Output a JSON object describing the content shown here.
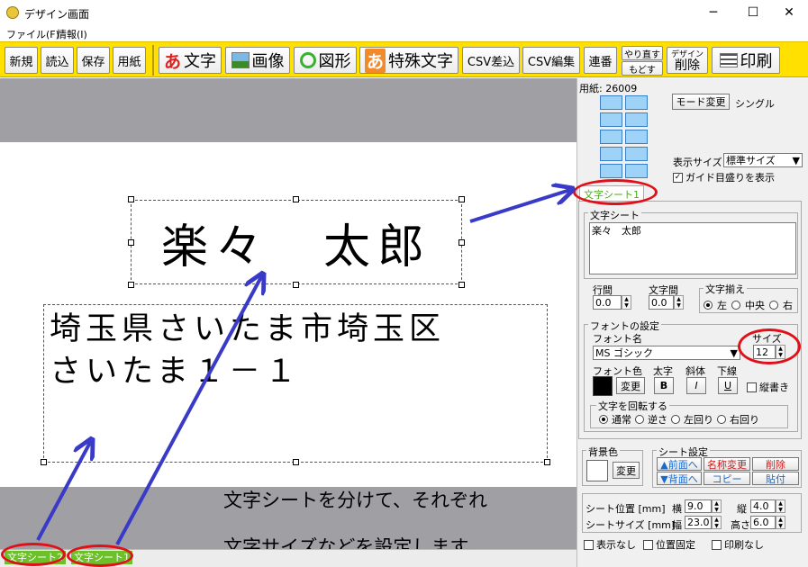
{
  "window": {
    "title": "デザイン画面",
    "minimize": "─",
    "maximize": "☐",
    "close": "✕"
  },
  "menu": [
    "ファイル(F)",
    "情報(I)"
  ],
  "toolbar": {
    "new": "新規",
    "load": "読込",
    "save": "保存",
    "paper": "用紙",
    "text": "文字",
    "image": "画像",
    "shape": "図形",
    "special_text": "特殊文字",
    "csv_merge": "CSV差込",
    "csv_edit": "CSV編集",
    "sequence": "連番",
    "redo": "やり直す",
    "undo": "もどす",
    "design": "デザイン",
    "delete": "削除",
    "print": "印刷",
    "text_icon_glyph": "あ"
  },
  "canvas": {
    "name_text": "楽々　太郎",
    "address_line1": "埼玉県さいたま市埼玉区",
    "address_line2": "さいたま１－１",
    "caption_line1": "文字シートを分けて、それぞれ",
    "caption_line2": "文字サイズなどを設定します。"
  },
  "sheets": [
    "文字シート2",
    "文字シート1"
  ],
  "panel": {
    "paper_label": "用紙: 26009",
    "mode_button": "モード変更",
    "mode_value": "シングル",
    "display_size_label": "表示サイズ",
    "display_size_value": "標準サイズ",
    "guide_checkbox": "ガイド目盛りを表示",
    "active_tab": "文字シート1",
    "text_sheet_group": "文字シート",
    "text_sheet_content": "楽々　太郎",
    "line_spacing_label": "行間",
    "line_spacing_value": "0.0",
    "char_spacing_label": "文字間",
    "char_spacing_value": "0.0",
    "align_label": "文字揃え",
    "align_options": [
      "左",
      "中央",
      "右"
    ],
    "font_group": "フォントの設定",
    "font_name_label": "フォント名",
    "font_name_value": "MS ゴシック",
    "size_label": "サイズ",
    "size_value": "12",
    "font_color_label": "フォント色",
    "change_button": "変更",
    "bold_label": "太字",
    "italic_label": "斜体",
    "underline_label": "下線",
    "bold_btn": "B",
    "italic_btn": "I",
    "underline_btn": "U",
    "vertical_label": "縦書き",
    "rotate_group": "文字を回転する",
    "rotate_options": [
      "通常",
      "逆さ",
      "左回り",
      "右回り"
    ],
    "bg_color_group": "背景色",
    "bg_change_button": "変更",
    "sheet_settings_group": "シート設定",
    "to_front": "▲前面へ",
    "to_back": "▼背面へ",
    "rename": "名称変更",
    "copy": "コピー",
    "delete": "削除",
    "paste": "貼付",
    "pos_label": "シート位置 [mm]",
    "x_label": "横",
    "x_value": "9.0",
    "y_label": "縦",
    "y_value": "4.0",
    "size_mm_label": "シートサイズ [mm]",
    "w_label": "幅",
    "w_value": "23.0",
    "h_label": "高さ",
    "h_value": "6.0",
    "hide_label": "表示なし",
    "lock_label": "位置固定",
    "noprint_label": "印刷なし"
  },
  "colors": {
    "toolbar": "#ffe000",
    "sheet_tab": "#6cc028",
    "highlight_ring": "#e0101a",
    "arrow": "#3a3ac8",
    "font_color": "#000000"
  }
}
